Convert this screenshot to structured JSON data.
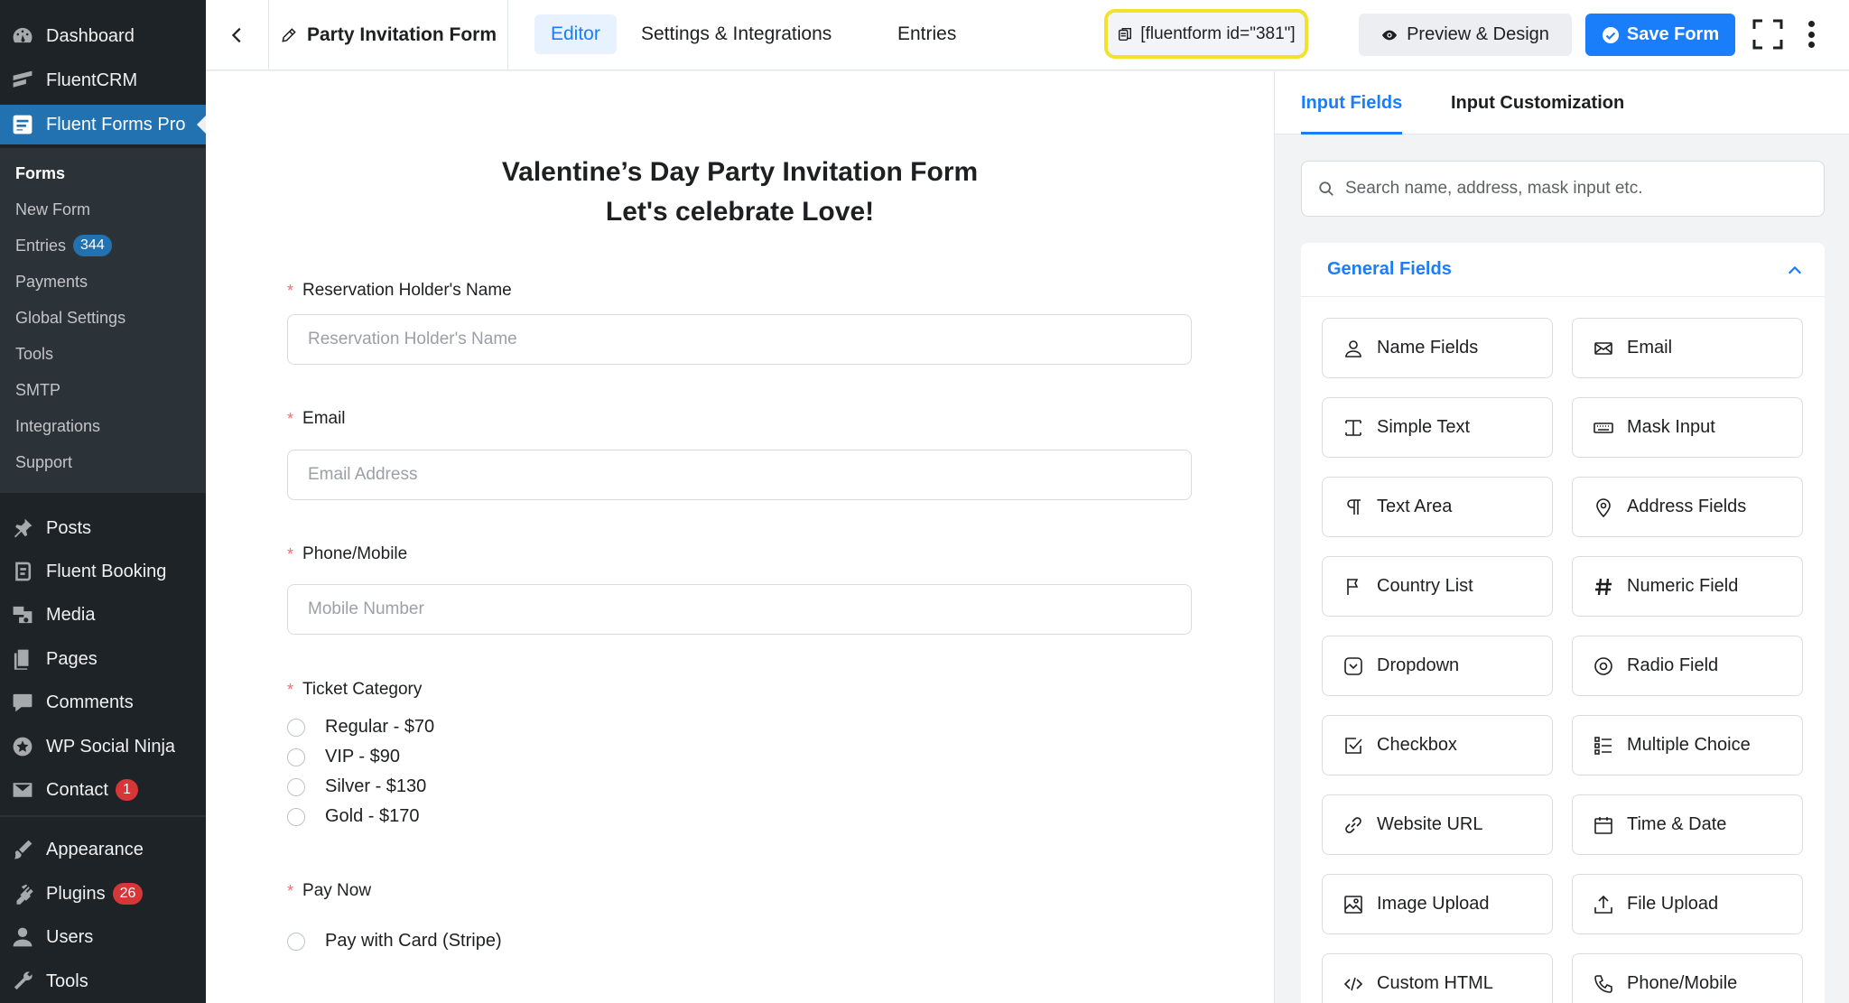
{
  "sidebar": {
    "menu": [
      {
        "label": "Dashboard",
        "icon": "dashboard-icon"
      },
      {
        "label": "FluentCRM",
        "icon": "fluentcrm-icon"
      },
      {
        "label": "Fluent Forms Pro",
        "icon": "fluent-forms-icon"
      }
    ],
    "submenu": [
      {
        "label": "Forms"
      },
      {
        "label": "New Form"
      },
      {
        "label": "Entries",
        "badge": "344"
      },
      {
        "label": "Payments"
      },
      {
        "label": "Global Settings"
      },
      {
        "label": "Tools"
      },
      {
        "label": "SMTP"
      },
      {
        "label": "Integrations"
      },
      {
        "label": "Support"
      }
    ],
    "menu2": [
      {
        "label": "Posts",
        "icon": "pin-icon"
      },
      {
        "label": "Fluent Booking",
        "icon": "booking-icon"
      },
      {
        "label": "Media",
        "icon": "media-icon"
      },
      {
        "label": "Pages",
        "icon": "pages-icon"
      },
      {
        "label": "Comments",
        "icon": "comments-icon"
      },
      {
        "label": "WP Social Ninja",
        "icon": "social-ninja-icon"
      },
      {
        "label": "Contact",
        "icon": "envelope-icon",
        "badge": "1"
      }
    ],
    "menu3": [
      {
        "label": "Appearance",
        "icon": "brush-icon"
      },
      {
        "label": "Plugins",
        "icon": "plugin-icon",
        "badge": "26"
      },
      {
        "label": "Users",
        "icon": "user-icon"
      },
      {
        "label": "Tools",
        "icon": "wrench-icon"
      }
    ]
  },
  "topbar": {
    "form_title": "Party Invitation Form",
    "tabs": [
      "Editor",
      "Settings & Integrations",
      "Entries"
    ],
    "shortcode": "[fluentform id=\"381\"]",
    "preview_label": "Preview & Design",
    "save_label": "Save Form"
  },
  "form": {
    "heading_line1": "Valentine’s Day Party Invitation Form",
    "heading_line2": "Let's celebrate Love!",
    "fields": [
      {
        "label": "Reservation Holder's Name",
        "placeholder": "Reservation Holder's Name"
      },
      {
        "label": "Email",
        "placeholder": "Email Address"
      },
      {
        "label": "Phone/Mobile",
        "placeholder": "Mobile Number"
      }
    ],
    "ticket_label": "Ticket Category",
    "ticket_options": [
      "Regular - $70",
      "VIP - $90",
      "Silver - $130",
      "Gold - $170"
    ],
    "pay_label": "Pay Now",
    "pay_options": [
      "Pay with Card (Stripe)"
    ]
  },
  "panel": {
    "tabs": [
      "Input Fields",
      "Input Customization"
    ],
    "search_placeholder": "Search name, address, mask input etc.",
    "section_title": "General Fields",
    "fields": [
      {
        "label": "Name Fields",
        "icon": "person-icon"
      },
      {
        "label": "Email",
        "icon": "envelope-icon"
      },
      {
        "label": "Simple Text",
        "icon": "text-cursor-icon"
      },
      {
        "label": "Mask Input",
        "icon": "keyboard-icon"
      },
      {
        "label": "Text Area",
        "icon": "paragraph-icon"
      },
      {
        "label": "Address Fields",
        "icon": "location-pin-icon"
      },
      {
        "label": "Country List",
        "icon": "flag-icon"
      },
      {
        "label": "Numeric Field",
        "icon": "hash-icon"
      },
      {
        "label": "Dropdown",
        "icon": "dropdown-icon"
      },
      {
        "label": "Radio Field",
        "icon": "radio-icon"
      },
      {
        "label": "Checkbox",
        "icon": "checkbox-icon"
      },
      {
        "label": "Multiple Choice",
        "icon": "list-icon"
      },
      {
        "label": "Website URL",
        "icon": "link-icon"
      },
      {
        "label": "Time & Date",
        "icon": "calendar-icon"
      },
      {
        "label": "Image Upload",
        "icon": "image-icon"
      },
      {
        "label": "File Upload",
        "icon": "upload-icon"
      },
      {
        "label": "Custom HTML",
        "icon": "code-icon"
      },
      {
        "label": "Phone/Mobile",
        "icon": "phone-icon"
      }
    ]
  },
  "colors": {
    "wp_sidebar": "#1d2327",
    "wp_active": "#2271b1",
    "accent": "#1a7efb",
    "highlight": "#f1e22b",
    "badge_red": "#d63638"
  }
}
